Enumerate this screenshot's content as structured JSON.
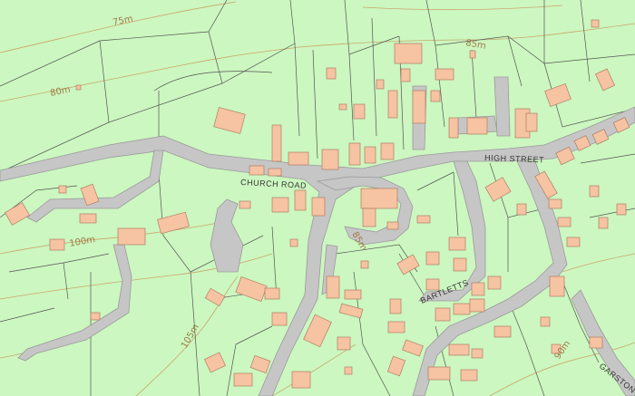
{
  "colors": {
    "land": "#ccf7c0",
    "road_fill": "#c6c6c6",
    "road_edge": "#9a9a9a",
    "building_fill": "#f6c3a3",
    "building_edge": "#b07e62",
    "parcel_line": "#555555",
    "contour_line": "#c9a66b",
    "label_text": "#333333",
    "contour_text": "#a0794a"
  },
  "roads": {
    "church_road": "CHURCH ROAD",
    "high_street": "HIGH STREET",
    "bartletts": "BARTLETTS",
    "garston": "GARSTON"
  },
  "contours": {
    "c75": "75m",
    "c80": "80m",
    "c85a": "85m",
    "c85b": "85m",
    "c90": "90m",
    "c100": "100m",
    "c105": "105m"
  }
}
